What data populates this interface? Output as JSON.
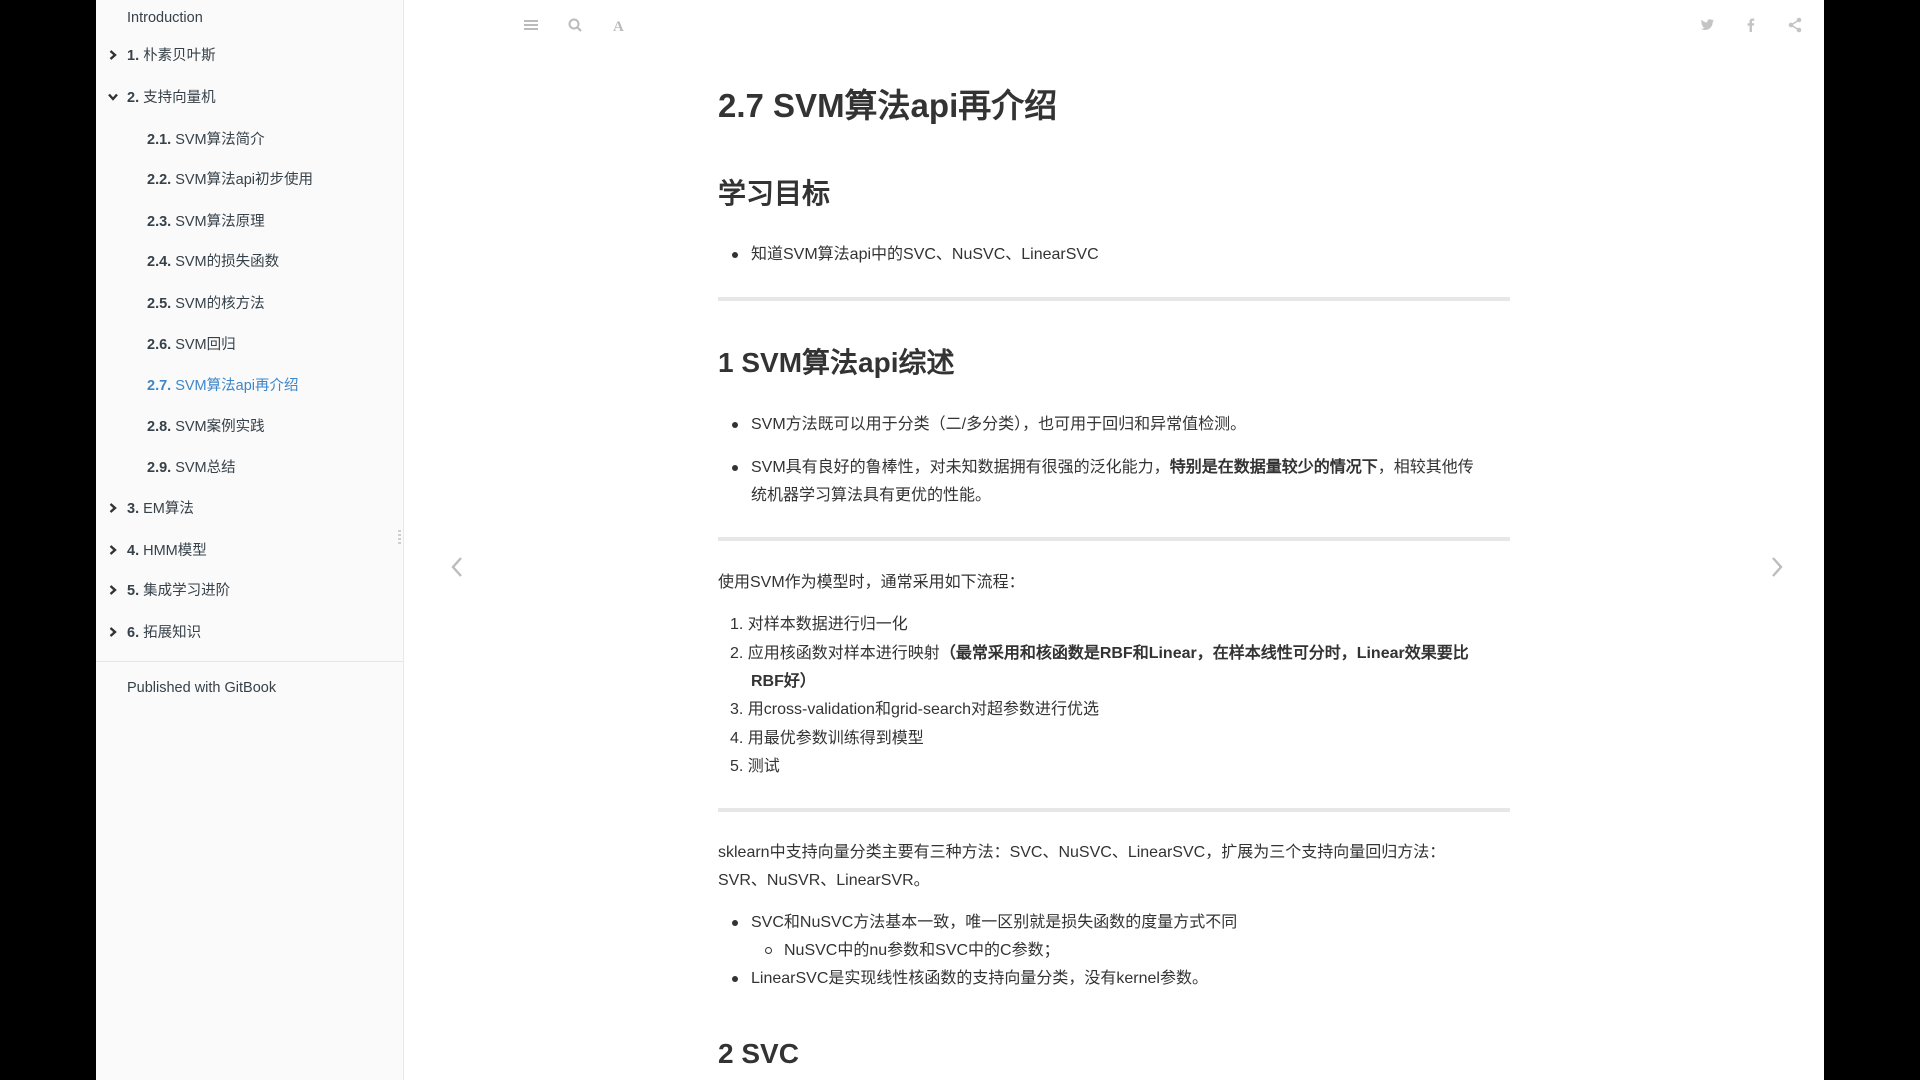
{
  "sidebar": {
    "items": [
      {
        "num": "",
        "label": "Introduction",
        "level": 0,
        "chevron": "none"
      },
      {
        "num": "1.",
        "label": "朴素贝叶斯",
        "level": 0,
        "chevron": "right"
      },
      {
        "num": "2.",
        "label": "支持向量机",
        "level": 0,
        "chevron": "down"
      },
      {
        "num": "2.1.",
        "label": "SVM算法简介",
        "level": 1,
        "chevron": "none"
      },
      {
        "num": "2.2.",
        "label": "SVM算法api初步使用",
        "level": 1,
        "chevron": "none"
      },
      {
        "num": "2.3.",
        "label": "SVM算法原理",
        "level": 1,
        "chevron": "none"
      },
      {
        "num": "2.4.",
        "label": "SVM的损失函数",
        "level": 1,
        "chevron": "none"
      },
      {
        "num": "2.5.",
        "label": "SVM的核方法",
        "level": 1,
        "chevron": "none"
      },
      {
        "num": "2.6.",
        "label": "SVM回归",
        "level": 1,
        "chevron": "none"
      },
      {
        "num": "2.7.",
        "label": "SVM算法api再介绍",
        "level": 1,
        "chevron": "none",
        "active": true
      },
      {
        "num": "2.8.",
        "label": "SVM案例实践",
        "level": 1,
        "chevron": "none"
      },
      {
        "num": "2.9.",
        "label": "SVM总结",
        "level": 1,
        "chevron": "none"
      },
      {
        "num": "3.",
        "label": "EM算法",
        "level": 0,
        "chevron": "right"
      },
      {
        "num": "4.",
        "label": "HMM模型",
        "level": 0,
        "chevron": "right"
      },
      {
        "num": "5.",
        "label": "集成学习进阶",
        "level": 0,
        "chevron": "right"
      },
      {
        "num": "6.",
        "label": "拓展知识",
        "level": 0,
        "chevron": "right"
      }
    ],
    "footer": "Published with GitBook",
    "active_color": "#3d86c9"
  },
  "toolbar": {
    "left_icons": [
      "menu-icon",
      "search-icon",
      "font-settings-icon"
    ],
    "right_icons": [
      "twitter-icon",
      "facebook-icon",
      "share-icon"
    ]
  },
  "navigation": {
    "prev": "chevron-left-icon",
    "next": "chevron-right-icon"
  },
  "content": {
    "title": "2.7 SVM算法api再介绍",
    "goals_heading": "学习目标",
    "goals": [
      "知道SVM算法api中的SVC、NuSVC、LinearSVC"
    ],
    "section1_heading": "1 SVM算法api综述",
    "section1_bullets": [
      {
        "text": "SVM方法既可以用于分类（二/多分类），也可用于回归和异常值检测。"
      },
      {
        "line1_pre": "SVM具有良好的鲁棒性，对未知数据拥有很强的泛化能力，",
        "line1_bold": "特别是在数据量较少的情况下",
        "line1_post": "，相较其他传",
        "line2": "统机器学习算法具有更优的性能。"
      }
    ],
    "flow_intro": "使用SVM作为模型时，通常采用如下流程：",
    "flow_steps": [
      {
        "n": "1.",
        "text": "对样本数据进行归一化"
      },
      {
        "n": "2.",
        "text": "应用核函数对样本进行映射",
        "bold_line1": "（最常采用和核函数是RBF和Linear，在样本线性可分时，Linear效果要比",
        "bold_line2": "RBF好）"
      },
      {
        "n": "3.",
        "text": "用cross-validation和grid-search对超参数进行优选"
      },
      {
        "n": "4.",
        "text": "用最优参数训练得到模型"
      },
      {
        "n": "5.",
        "text": "测试"
      }
    ],
    "sklearn_line1": "sklearn中支持向量分类主要有三种方法：SVC、NuSVC、LinearSVC，扩展为三个支持向量回归方法：",
    "sklearn_line2": "SVR、NuSVR、LinearSVR。",
    "sklearn_bullets": [
      "SVC和NuSVC方法基本一致，唯一区别就是损失函数的度量方式不同",
      "NuSVC中的nu参数和SVC中的C参数；",
      "LinearSVC是实现线性核函数的支持向量分类，没有kernel参数。"
    ],
    "section2_heading": "2 SVC"
  }
}
